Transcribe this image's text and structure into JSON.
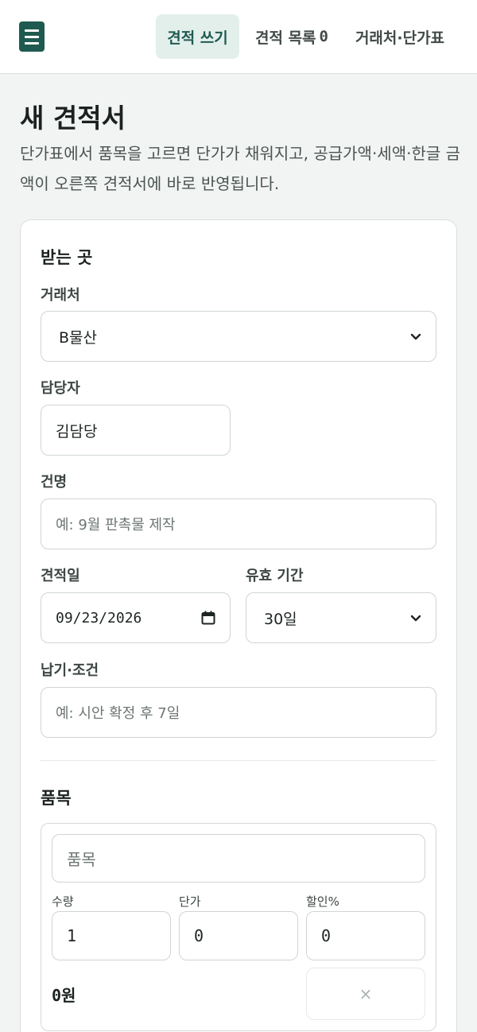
{
  "nav": {
    "tabs": [
      {
        "label": "견적 쓰기",
        "active": true
      },
      {
        "label": "견적 목록",
        "count": "0"
      },
      {
        "label": "거래처·단가표"
      }
    ]
  },
  "page": {
    "title": "새 견적서",
    "description": "단가표에서 품목을 고르면 단가가 채워지고, 공급가액·세액·한글 금액이 오른쪽 견적서에 바로 반영됩니다."
  },
  "recipient": {
    "section_title": "받는 곳",
    "client_label": "거래처",
    "client_value": "B물산",
    "contact_label": "담당자",
    "contact_value": "김담당",
    "subject_label": "건명",
    "subject_placeholder": "예: 9월 판촉물 제작",
    "date_label": "견적일",
    "date_value": "09/23/2026",
    "validity_label": "유효 기간",
    "validity_value": "30일",
    "terms_label": "납기·조건",
    "terms_placeholder": "예: 시안 확정 후 7일"
  },
  "items": {
    "section_title": "품목",
    "item_placeholder": "품목",
    "qty_label": "수량",
    "qty_value": "1",
    "price_label": "단가",
    "price_value": "0",
    "discount_label": "할인%",
    "discount_value": "0",
    "line_total_value": "0",
    "line_total_unit": "원",
    "remove_label": "×"
  },
  "colors": {
    "brand": "#1f5a50",
    "active_tab_bg": "#e3efeb",
    "page_bg": "#f2f4f3"
  }
}
